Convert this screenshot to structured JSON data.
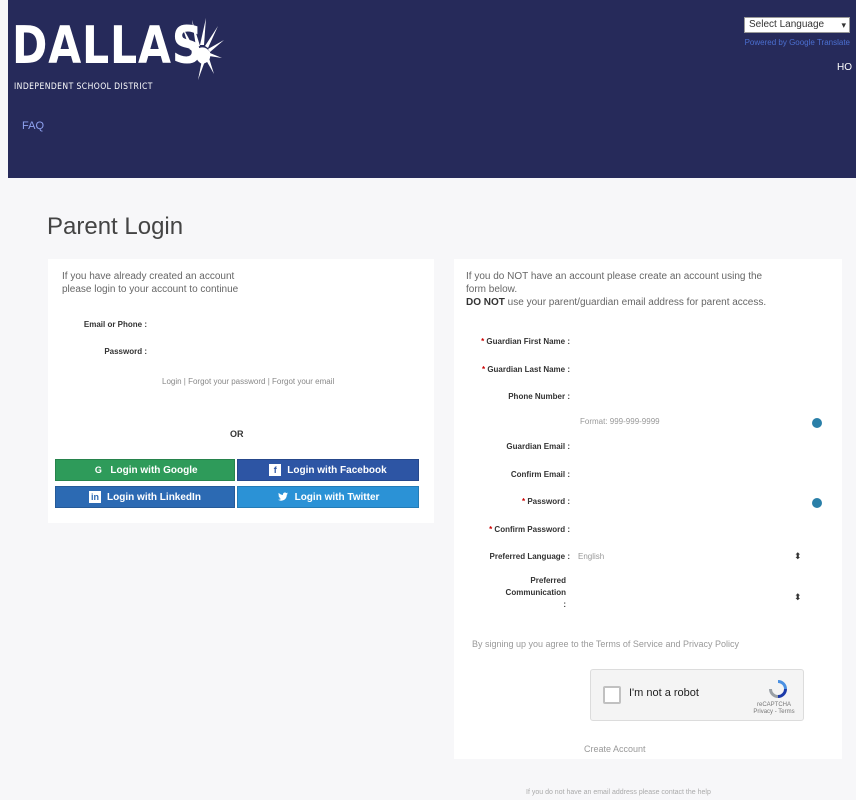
{
  "header": {
    "logo_word": "DALLAS",
    "logo_subtitle": "INDEPENDENT SCHOOL DISTRICT",
    "language_select": "Select Language",
    "powered_by": "Powered by Google Translate",
    "right_link": "HO",
    "faq": "FAQ",
    "bg_color": "#262a5a"
  },
  "page_title": "Parent Login",
  "login": {
    "intro_line1": "If you have already created an account",
    "intro_line2": "please login to your account to continue",
    "email_label": "Email or Phone :",
    "password_label": "Password :",
    "links": "Login  |  Forgot your password  |  Forgot your email",
    "or": "OR",
    "social": {
      "google": "Login with Google",
      "facebook": "Login with Facebook",
      "linkedin": "Login with LinkedIn",
      "twitter": "Login with Twitter"
    }
  },
  "register": {
    "intro_line1": "If you do NOT have an account please create an account using the",
    "intro_line2": "form below.",
    "intro_line3_prefix": "DO NOT",
    "intro_line3_rest": "use your parent/guardian email address for parent access.",
    "fields": {
      "first_name": "Guardian First Name :",
      "last_name": "Guardian Last Name :",
      "phone": "Phone Number :",
      "phone_hint": "Format: 999-999-9999",
      "email": "Guardian Email :",
      "confirm_email": "Confirm Email :",
      "password": "Password :",
      "confirm_password": "Confirm Password :",
      "language": "Preferred Language :",
      "language_value": "English",
      "communication_line1": "Preferred",
      "communication_line2": "Communication",
      "communication_line3": ":"
    },
    "terms": "By signing up you agree to the Terms of Service and Privacy Policy",
    "captcha_label": "I'm not a robot",
    "captcha_brand": "reCAPTCHA",
    "captcha_links": "Privacy - Terms",
    "create_account": "Create Account"
  },
  "footer_note": "If you do not have an email address please contact the help"
}
